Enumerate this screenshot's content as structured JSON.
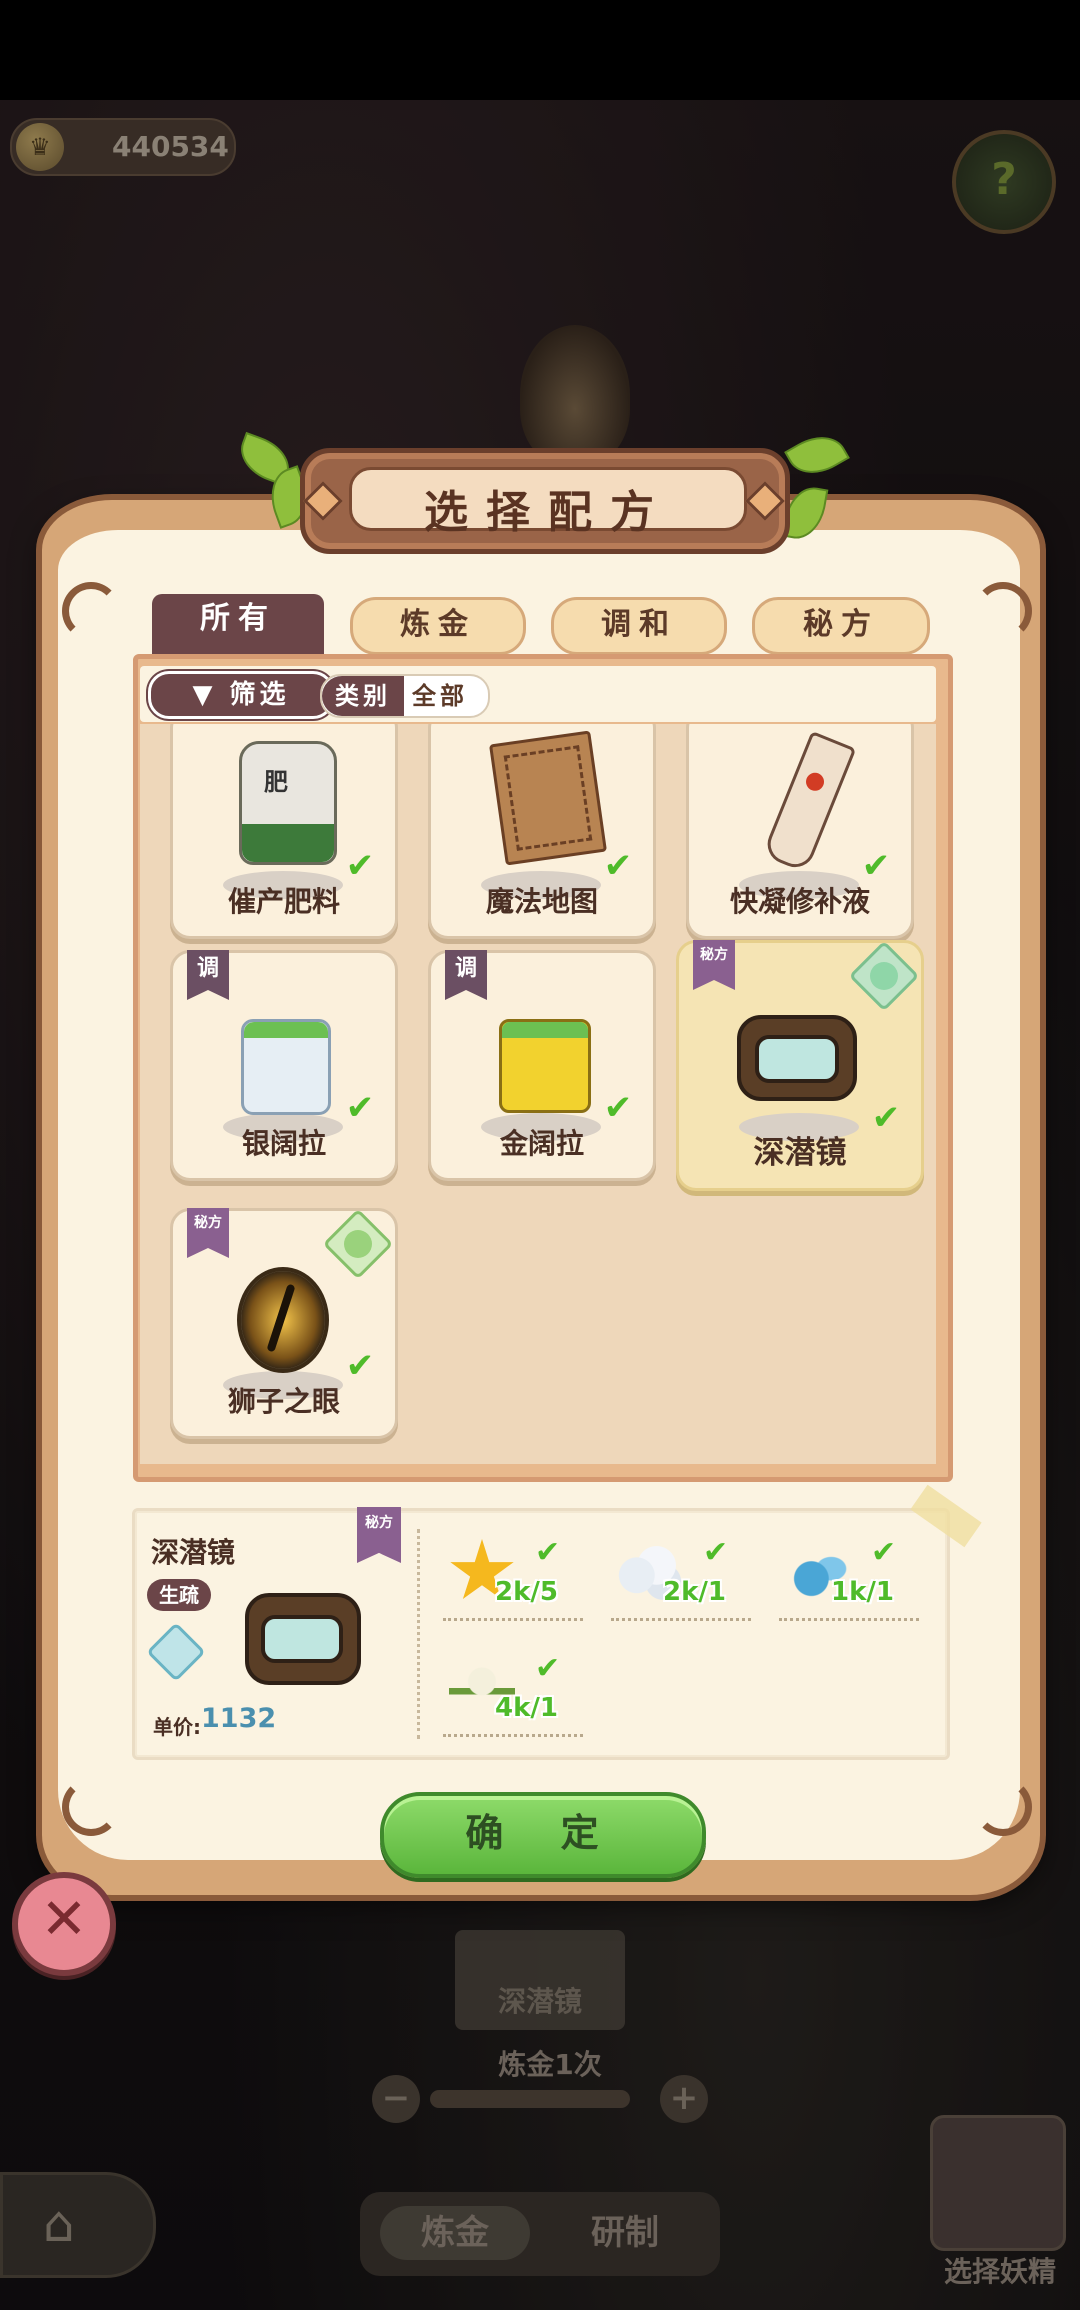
{
  "hud": {
    "coins": "440534",
    "help_icon": "question-icon"
  },
  "dialog": {
    "title": "选择配方",
    "tabs": [
      {
        "label": "所有",
        "active": true
      },
      {
        "label": "炼金",
        "active": false
      },
      {
        "label": "调和",
        "active": false
      },
      {
        "label": "秘方",
        "active": false
      }
    ],
    "filter": {
      "button_label": "筛选",
      "category_label": "类别",
      "category_value": "全部"
    },
    "recipes": [
      {
        "name": "催产肥料",
        "tag": "",
        "art": "fertilizer-bag",
        "owned": true
      },
      {
        "name": "魔法地图",
        "tag": "",
        "art": "magic-map",
        "owned": true
      },
      {
        "name": "快凝修补液",
        "tag": "",
        "art": "repair-tube",
        "owned": true
      },
      {
        "name": "银阔拉",
        "tag": "调",
        "art": "silver-bag",
        "owned": true
      },
      {
        "name": "金阔拉",
        "tag": "调",
        "art": "gold-bag",
        "owned": true
      },
      {
        "name": "深潜镜",
        "tag": "秘方",
        "art": "diving-goggles",
        "owned": true,
        "selected": true,
        "gem": "rarity-gem-icon"
      },
      {
        "name": "狮子之眼",
        "tag": "秘方",
        "art": "lion-eye",
        "owned": true,
        "gem": "rarity-gem-icon"
      }
    ],
    "detail": {
      "name": "深潜镜",
      "badge": "生疏",
      "tag": "秘方",
      "price_label": "单价:",
      "price": "1132",
      "ingredients": [
        {
          "icon": "star-icon",
          "count": "2k/5"
        },
        {
          "icon": "cloud-icon",
          "count": "2k/1"
        },
        {
          "icon": "water-icon",
          "count": "1k/1"
        },
        {
          "icon": "flower-icon",
          "count": "4k/1"
        }
      ]
    },
    "confirm_label": "确 定"
  },
  "background": {
    "card_label": "深潜镜",
    "count_label": "炼金1次",
    "bottom_tabs": [
      "炼金",
      "研制"
    ],
    "spirit_label": "选择妖精"
  }
}
